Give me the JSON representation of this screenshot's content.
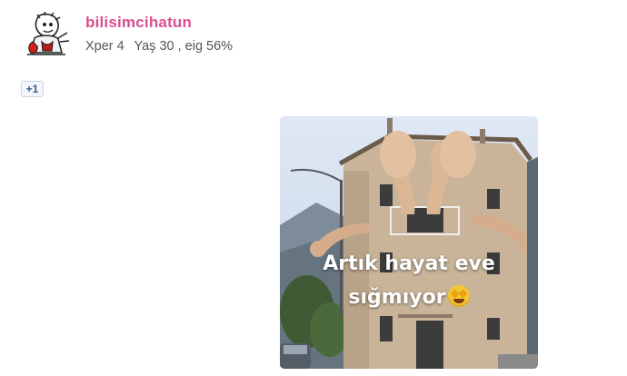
{
  "post": {
    "username": "bilisimcihatun",
    "device": "Xper 4",
    "age": "Yaş 30 , eig 56%",
    "plus_one": "+1"
  },
  "image": {
    "caption_line1": "Artık hayat eve",
    "caption_line2": "sığmıyor",
    "caption_emoji": "star-struck-emoji-icon"
  }
}
